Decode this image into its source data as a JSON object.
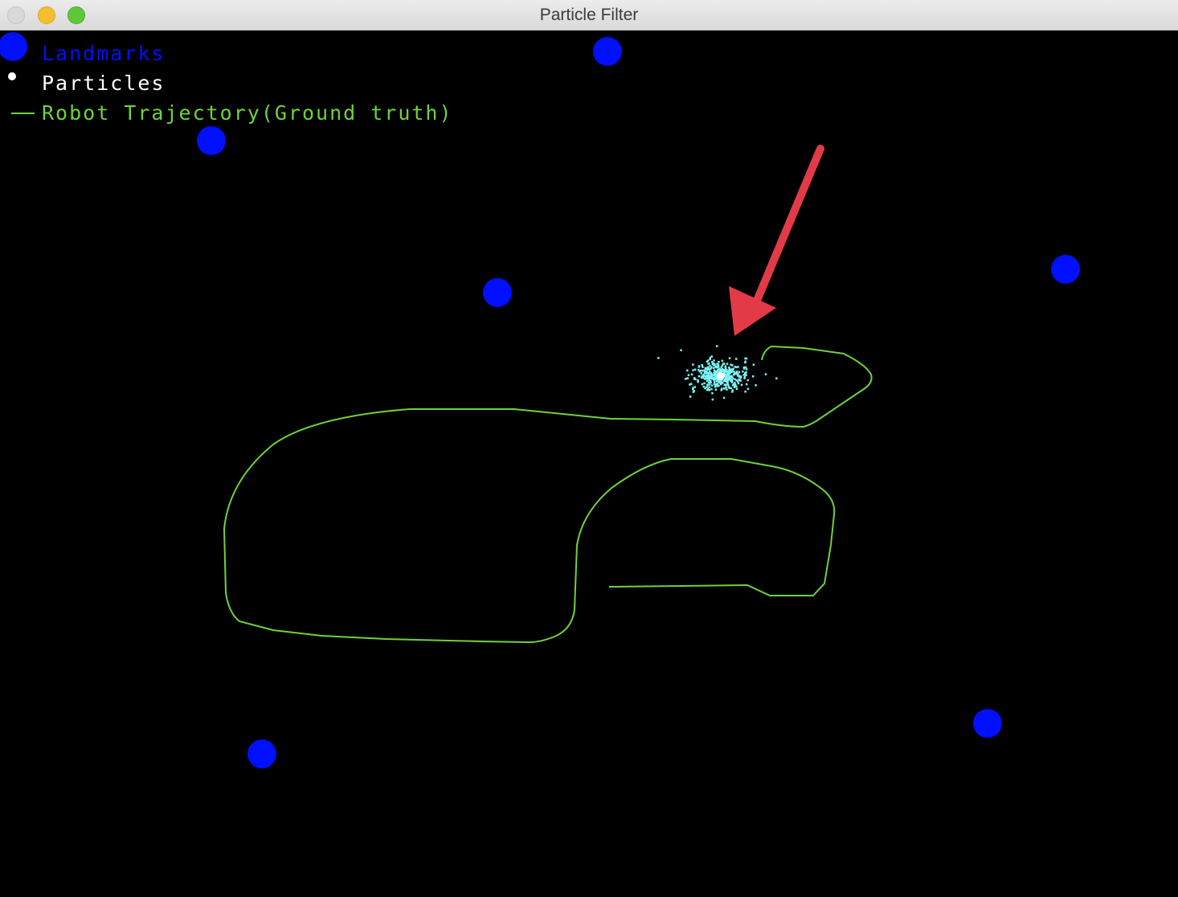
{
  "window": {
    "title": "Particle Filter"
  },
  "legend": {
    "landmarks_label": "Landmarks",
    "particles_label": "Particles",
    "trajectory_label": "Robot Trajectory(Ground truth)"
  },
  "colors": {
    "landmark": "#0010ff",
    "particle": "#7df3f6",
    "particle_center": "#ffffff",
    "trajectory": "#6fd23a",
    "legend_particles_text": "#ffffff",
    "annotation_arrow": "#e23a47",
    "background": "#000000"
  },
  "landmark_count": 7,
  "icons": {
    "close": "close-window-icon",
    "minimize": "minimize-window-icon",
    "maximize": "maximize-window-icon",
    "annotation": "red-arrow-annotation-icon"
  }
}
